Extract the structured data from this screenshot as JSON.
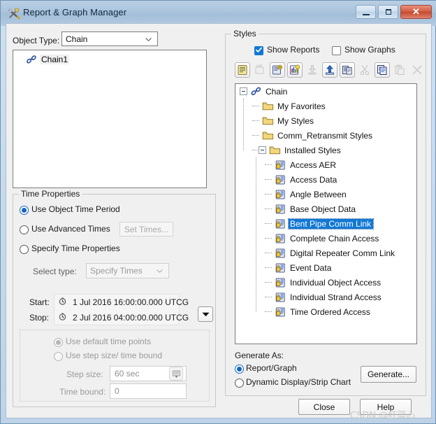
{
  "window": {
    "title": "Report & Graph Manager",
    "icon": "tools-icon",
    "controls": {
      "minimize": "minimize-button",
      "maximize": "maximize-button",
      "close": "close-button",
      "close_glyph": "✕"
    }
  },
  "left_panel": {
    "object_type_label": "Object Type:",
    "object_type_value": "Chain",
    "object_list": [
      {
        "label": "Chain1",
        "icon": "chain-icon",
        "selected": true
      }
    ],
    "time_properties": {
      "title": "Time Properties",
      "options": [
        {
          "label": "Use Object Time Period",
          "selected": true,
          "enabled": true
        },
        {
          "label": "Use Advanced Times",
          "selected": false,
          "enabled": true
        },
        {
          "label": "Specify Time Properties",
          "selected": false,
          "enabled": true
        }
      ],
      "set_times_button": "Set Times...",
      "select_type_label": "Select type:",
      "select_type_value": "Specify Times",
      "start_label": "Start:",
      "start_value": "1 Jul 2016 16:00:00.000 UTCG",
      "stop_label": "Stop:",
      "stop_value": "2 Jul 2016 04:00:00.000 UTCG",
      "dropdown_button": "▼",
      "time_point_options": [
        {
          "label": "Use default time points",
          "selected": true
        },
        {
          "label": "Use step size/ time bound",
          "selected": false
        }
      ],
      "step_size_label": "Step size:",
      "step_size_value": "60 sec",
      "time_bound_label": "Time bound:",
      "time_bound_value": "0"
    }
  },
  "right_panel": {
    "title": "Styles",
    "checkboxes": [
      {
        "label": "Show Reports",
        "checked": true
      },
      {
        "label": "Show Graphs",
        "checked": false
      }
    ],
    "toolbar": [
      {
        "name": "new-report-style-icon",
        "enabled": true,
        "framed": true
      },
      {
        "name": "new-graph-style-icon",
        "enabled": false,
        "framed": false
      },
      {
        "name": "duplicate-report-style-icon",
        "enabled": true,
        "framed": true
      },
      {
        "name": "duplicate-graph-style-icon",
        "enabled": true,
        "framed": true
      },
      {
        "name": "import-style-icon",
        "enabled": false,
        "framed": false
      },
      {
        "name": "export-style-icon",
        "enabled": true,
        "framed": true
      },
      {
        "name": "copy-style-to-icon",
        "enabled": true,
        "framed": true
      },
      {
        "name": "cut-icon",
        "enabled": false,
        "framed": false
      },
      {
        "name": "copy-icon",
        "enabled": true,
        "framed": true
      },
      {
        "name": "paste-icon",
        "enabled": false,
        "framed": false
      },
      {
        "name": "delete-icon",
        "enabled": false,
        "framed": false
      }
    ],
    "tree": [
      {
        "label": "Chain",
        "depth": 0,
        "icon": "chain-icon",
        "expander": "minus",
        "selected": false
      },
      {
        "label": "My Favorites",
        "depth": 1,
        "icon": "folder-icon",
        "expander": "none",
        "selected": false
      },
      {
        "label": "My Styles",
        "depth": 1,
        "icon": "folder-icon",
        "expander": "none",
        "selected": false
      },
      {
        "label": "Comm_Retransmit Styles",
        "depth": 1,
        "icon": "folder-icon",
        "expander": "none",
        "selected": false
      },
      {
        "label": "Installed Styles",
        "depth": 1,
        "icon": "folder-icon",
        "expander": "minus",
        "selected": false
      },
      {
        "label": "Access AER",
        "depth": 2,
        "icon": "locked-style-icon",
        "expander": "none",
        "selected": false
      },
      {
        "label": "Access Data",
        "depth": 2,
        "icon": "locked-style-icon",
        "expander": "none",
        "selected": false
      },
      {
        "label": "Angle Between",
        "depth": 2,
        "icon": "locked-style-icon",
        "expander": "none",
        "selected": false
      },
      {
        "label": "Base Object Data",
        "depth": 2,
        "icon": "locked-style-icon",
        "expander": "none",
        "selected": false
      },
      {
        "label": "Bent Pipe Comm Link",
        "depth": 2,
        "icon": "locked-style-icon",
        "expander": "none",
        "selected": true
      },
      {
        "label": "Complete Chain Access",
        "depth": 2,
        "icon": "locked-style-icon",
        "expander": "none",
        "selected": false
      },
      {
        "label": "Digital Repeater Comm Link",
        "depth": 2,
        "icon": "locked-style-icon",
        "expander": "none",
        "selected": false
      },
      {
        "label": "Event Data",
        "depth": 2,
        "icon": "locked-style-icon",
        "expander": "none",
        "selected": false
      },
      {
        "label": "Individual Object Access",
        "depth": 2,
        "icon": "locked-style-icon",
        "expander": "none",
        "selected": false
      },
      {
        "label": "Individual Strand Access",
        "depth": 2,
        "icon": "locked-style-icon",
        "expander": "none",
        "selected": false
      },
      {
        "label": "Time Ordered Access",
        "depth": 2,
        "icon": "locked-style-icon",
        "expander": "none",
        "selected": false
      }
    ],
    "generate_as": {
      "label": "Generate As:",
      "options": [
        {
          "label": "Report/Graph",
          "selected": true
        },
        {
          "label": "Dynamic Display/Strip Chart",
          "selected": false
        }
      ],
      "generate_button": "Generate..."
    }
  },
  "footer": {
    "close_button": "Close",
    "help_button": "Help"
  },
  "watermark": "CSDN @红蓝心",
  "colors": {
    "accent": "#1278d4",
    "title_bar": "#a9c3dc",
    "close_button": "#c44a31",
    "folder": "#f2d47a",
    "selection": "#1278d4"
  }
}
